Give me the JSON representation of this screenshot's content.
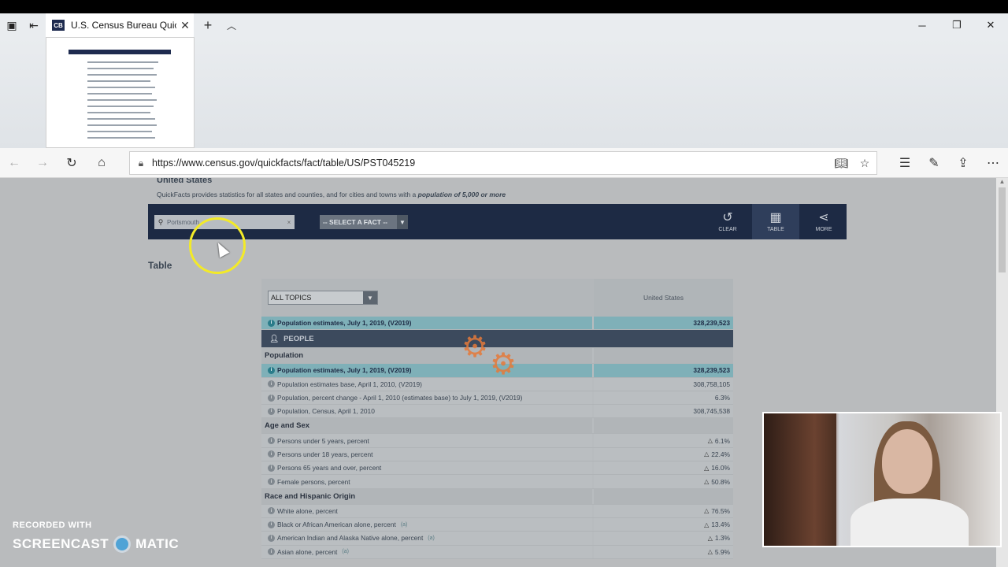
{
  "browser": {
    "tab_title": "U.S. Census Bureau Quic",
    "tab_favicon": "CB",
    "url": "https://www.census.gov/quickfacts/fact/table/US/PST045219"
  },
  "page": {
    "header": "United States",
    "subtitle_prefix": "QuickFacts provides statistics for all states and counties, and for cities and towns with a ",
    "subtitle_bold": "population of 5,000 or more",
    "search_value": "Portsmouth",
    "fact_select": "-- SELECT A FACT --",
    "buttons": {
      "clear": "CLEAR",
      "table": "TABLE",
      "more": "MORE"
    },
    "table_label": "Table",
    "topics_select": "ALL TOPICS",
    "column_header": "United States"
  },
  "table": {
    "top_row": {
      "label": "Population estimates, July 1, 2019, (V2019)",
      "value": "328,239,523"
    },
    "people_label": "PEOPLE",
    "sections": [
      {
        "title": "Population",
        "rows": [
          {
            "label": "Population estimates, July 1, 2019, (V2019)",
            "value": "328,239,523",
            "highlight": true
          },
          {
            "label": "Population estimates base, April 1, 2010, (V2019)",
            "value": "308,758,105"
          },
          {
            "label": "Population, percent change - April 1, 2010 (estimates base) to July 1, 2019, (V2019)",
            "value": "6.3%"
          },
          {
            "label": "Population, Census, April 1, 2010",
            "value": "308,745,538"
          }
        ]
      },
      {
        "title": "Age and Sex",
        "rows": [
          {
            "label": "Persons under 5 years, percent",
            "value": "6.1%",
            "flag": true
          },
          {
            "label": "Persons under 18 years, percent",
            "value": "22.4%",
            "flag": true
          },
          {
            "label": "Persons 65 years and over, percent",
            "value": "16.0%",
            "flag": true
          },
          {
            "label": "Female persons, percent",
            "value": "50.8%",
            "flag": true
          }
        ]
      },
      {
        "title": "Race and Hispanic Origin",
        "rows": [
          {
            "label": "White alone, percent",
            "value": "76.5%",
            "flag": true
          },
          {
            "label": "Black or African American alone, percent",
            "value": "13.4%",
            "flag": true,
            "footnote": "(a)"
          },
          {
            "label": "American Indian and Alaska Native alone, percent",
            "value": "1.3%",
            "flag": true,
            "footnote": "(a)"
          },
          {
            "label": "Asian alone, percent",
            "value": "5.9%",
            "flag": true,
            "footnote": "(a)"
          }
        ]
      }
    ]
  },
  "watermark": {
    "line1": "RECORDED WITH",
    "brand_left": "SCREENCAST",
    "brand_right": "MATIC"
  }
}
